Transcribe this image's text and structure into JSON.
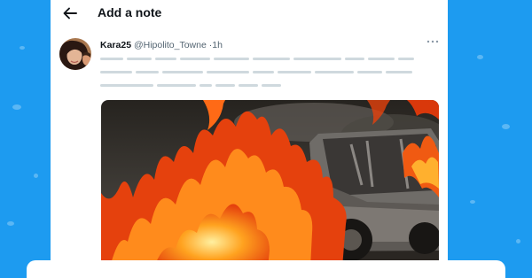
{
  "header": {
    "title": "Add a note",
    "back_icon": "arrow-left-icon"
  },
  "tweet": {
    "display_name": "Kara25",
    "handle": "@Hipolito_Towne",
    "separator": "·",
    "time": "1h",
    "more_icon": "more-horizontal-icon",
    "media_description": "burning car"
  },
  "colors": {
    "background": "#1d9bf0",
    "text_primary": "#0f1419",
    "text_secondary": "#536471",
    "skeleton": "#cfd9de"
  }
}
